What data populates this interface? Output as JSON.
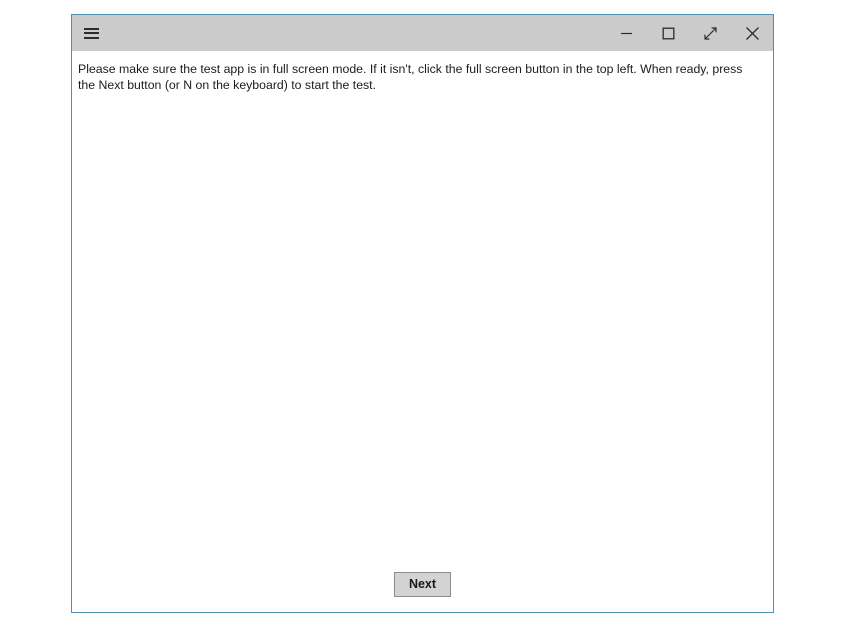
{
  "window": {
    "border_color": "#4b93b5",
    "titlebar": {
      "background": "#cbcbcb",
      "menu_icon": "hamburger-menu-icon",
      "controls": [
        {
          "name": "minimize",
          "icon": "minimize-icon",
          "label": "Minimize"
        },
        {
          "name": "maximize",
          "icon": "maximize-icon",
          "label": "Maximize"
        },
        {
          "name": "fullscreen",
          "icon": "fullscreen-diagonal-arrows-icon",
          "label": "Full screen"
        },
        {
          "name": "close",
          "icon": "close-x-icon",
          "label": "Close"
        }
      ]
    }
  },
  "content": {
    "instruction": "Please make sure the test app is in full screen mode. If it isn't, click the full screen button in the top left. When ready, press the Next button (or N on the keyboard) to start the test."
  },
  "footer": {
    "next_label": "Next"
  }
}
